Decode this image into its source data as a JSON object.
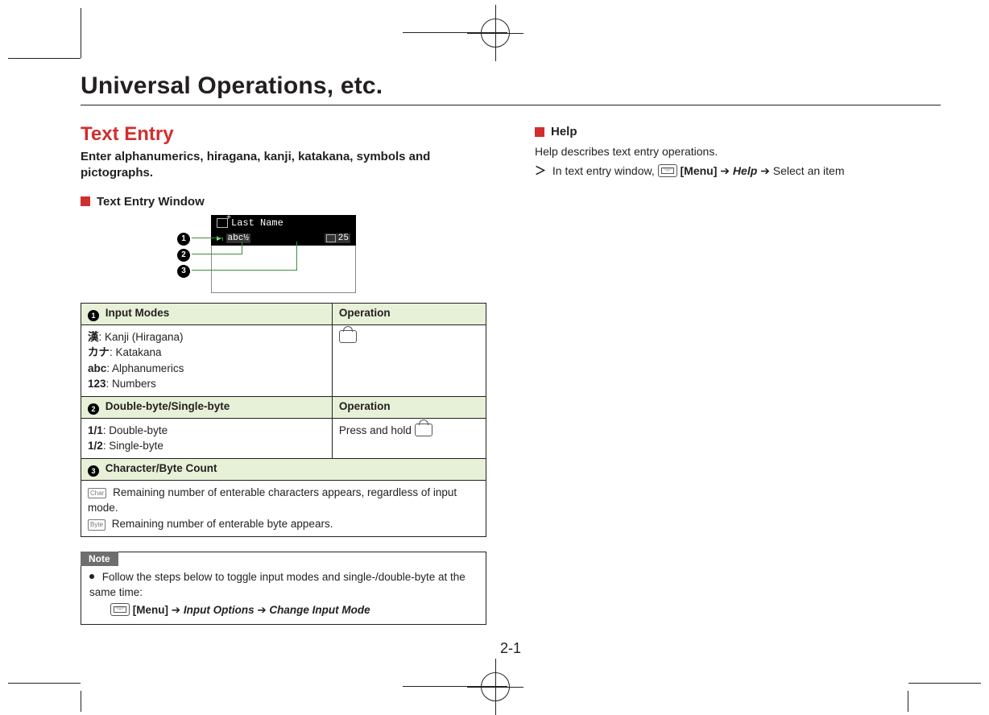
{
  "chapter_title": "Universal Operations, etc.",
  "page_number": "2-1",
  "left": {
    "heading": "Text Entry",
    "lead": "Enter alphanumerics, hiragana, kanji, katakana, symbols and pictographs.",
    "section_title": "Text Entry Window",
    "screenshot": {
      "title": "Last Name",
      "mode_badge": "abc½",
      "count_badge": "25"
    },
    "callouts": [
      "1",
      "2",
      "3"
    ],
    "table": {
      "row1": {
        "callout": "1",
        "header_left": "Input Modes",
        "header_right": "Operation",
        "modes": {
          "kanji_sym": "漢",
          "kanji_label": ": Kanji (Hiragana)",
          "kata_sym": "カナ",
          "kata_label": ": Katakana",
          "abc_sym": "abc",
          "abc_label": ": Alphanumerics",
          "num_sym": "123",
          "num_label": ": Numbers"
        }
      },
      "row2": {
        "callout": "2",
        "header_left": "Double-byte/Single-byte",
        "header_right": "Operation",
        "c1_a_sym": "1/1",
        "c1_a_label": ": Double-byte",
        "c1_b_sym": "1/2",
        "c1_b_label": ": Single-byte",
        "c2": "Press and hold "
      },
      "row3": {
        "callout": "3",
        "header": "Character/Byte Count",
        "line1": "Remaining number of enterable characters appears, regardless of input mode.",
        "line2": "Remaining number of enterable byte appears."
      }
    },
    "note": {
      "tab": "Note",
      "bullet": "Follow the steps below to toggle input modes and single-/double-byte at the same time:",
      "step_menu": "[Menu]",
      "step_a": "Input Options",
      "step_b": "Change Input Mode"
    }
  },
  "right": {
    "section_title": "Help",
    "desc": "Help describes text entry operations.",
    "step_prefix": "In text entry window, ",
    "step_menu": "[Menu]",
    "step_help": "Help",
    "step_tail": "Select an item"
  }
}
